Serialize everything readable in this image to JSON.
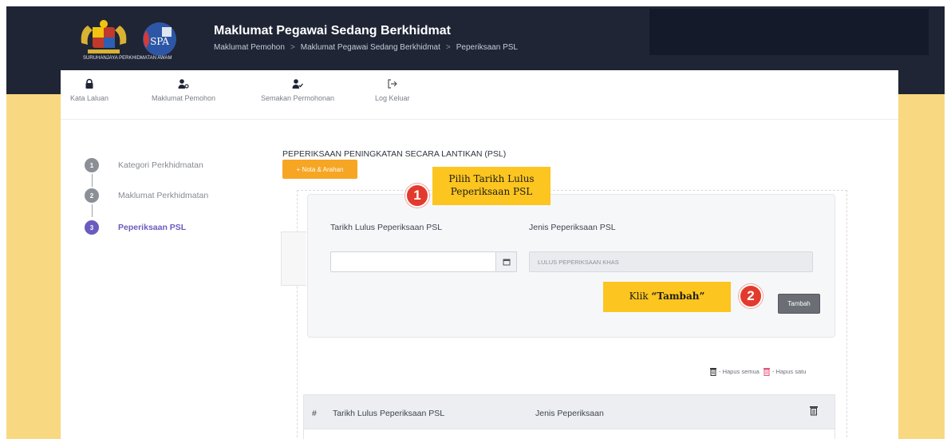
{
  "header": {
    "logo_caption": "SURUHANJAYA PERKHIDMATAN AWAM",
    "title": "Maklumat Pegawai Sedang Berkhidmat",
    "breadcrumb": [
      "Maklumat Pemohon",
      "Maklumat Pegawai Sedang Berkhidmat",
      "Peperiksaan PSL"
    ],
    "breadcrumb_separator": ">"
  },
  "nav": {
    "items": [
      {
        "label": "Kata Laluan",
        "icon": "lock-icon"
      },
      {
        "label": "Maklumat Pemohon",
        "icon": "user-settings-icon"
      },
      {
        "label": "Semakan Permohonan",
        "icon": "user-check-icon"
      },
      {
        "label": "Log Keluar",
        "icon": "logout-icon"
      }
    ]
  },
  "stepper": {
    "steps": [
      {
        "number": "1",
        "label": "Kategori Perkhidmatan",
        "active": false
      },
      {
        "number": "2",
        "label": "Maklumat Perkhidmatan",
        "active": false
      },
      {
        "number": "3",
        "label": "Peperiksaan PSL",
        "active": true
      }
    ]
  },
  "main": {
    "section_title": "PEPERIKSAAN PENINGKATAN SECARA LANTIKAN (PSL)",
    "nota_button": "+ Nota & Arahan",
    "form": {
      "date_label": "Tarikh Lulus Peperiksaan PSL",
      "date_value": "",
      "type_label": "Jenis Peperiksaan PSL",
      "type_value": "LULUS PEPERIKSAAN KHAS",
      "add_button": "Tambah"
    },
    "legend": {
      "delete_all": "- Hapus semua",
      "delete_one": "- Hapus satu"
    },
    "table": {
      "columns": [
        "#",
        "Tarikh Lulus Peperiksaan PSL",
        "Jenis Peperiksaan"
      ]
    }
  },
  "annotations": {
    "step1_number": "1",
    "step1_text": [
      "Pilih Tarikh Lulus",
      "Peperiksaan PSL"
    ],
    "step2_number": "2",
    "step2_prefix": "Klik ",
    "step2_bold": "“Tambah”"
  },
  "colors": {
    "topbar": "#1f2535",
    "background_accent": "#f8d981",
    "active_step": "#6a5bbf",
    "nota_button": "#f6a623",
    "callout": "#fcc51f",
    "badge": "#e23b2e"
  }
}
